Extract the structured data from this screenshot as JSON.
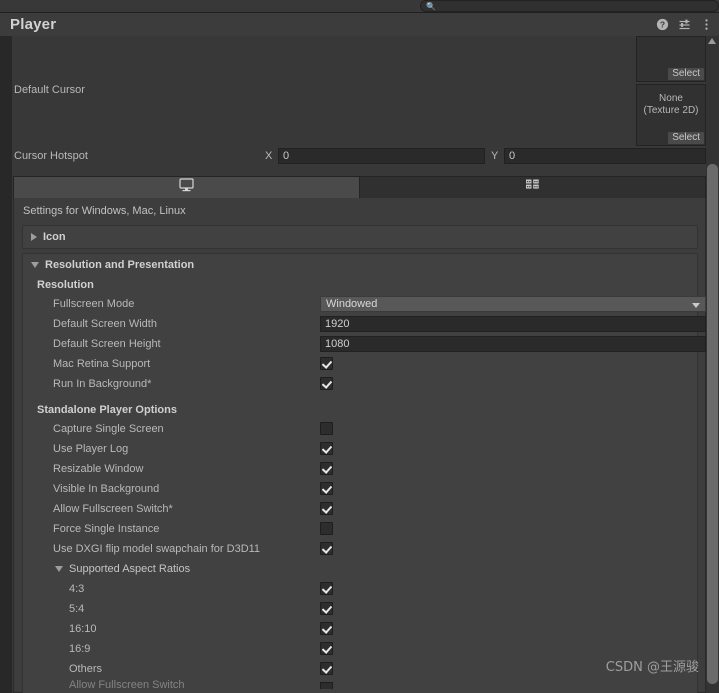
{
  "search": {
    "value": "",
    "placeholder": "",
    "icon": "search-icon"
  },
  "header": {
    "title": "Player",
    "icons": [
      {
        "name": "help-icon",
        "label": "?"
      },
      {
        "name": "preset-icon",
        "label": ""
      },
      {
        "name": "more-menu-icon",
        "label": ""
      }
    ]
  },
  "top_section": {
    "pickers": [
      {
        "name": "picker-top",
        "label": "",
        "select_label": "Select"
      },
      {
        "name": "picker-default-cursor",
        "label": "None\n(Texture 2D)",
        "line1": "None",
        "line2": "(Texture 2D)",
        "select_label": "Select"
      }
    ],
    "default_cursor_label": "Default Cursor",
    "cursor_hotspot": {
      "label": "Cursor Hotspot",
      "x_label": "X",
      "x_value": "0",
      "y_label": "Y",
      "y_value": "0"
    }
  },
  "tabs": [
    {
      "name": "tab-standalone",
      "icon": "monitor-icon",
      "active": true
    },
    {
      "name": "tab-webgl",
      "icon": "grid-server-icon",
      "active": false
    }
  ],
  "panel": {
    "settings_for": "Settings for Windows, Mac, Linux",
    "icon_foldout": {
      "label": "Icon",
      "expanded": false
    },
    "resolution_foldout": {
      "label": "Resolution and Presentation",
      "expanded": true
    },
    "resolution_group": {
      "heading": "Resolution",
      "fullscreen_mode": {
        "label": "Fullscreen Mode",
        "value": "Windowed"
      },
      "default_screen_width": {
        "label": "Default Screen Width",
        "value": "1920"
      },
      "default_screen_height": {
        "label": "Default Screen Height",
        "value": "1080"
      },
      "checkboxes": [
        {
          "label": "Mac Retina Support",
          "checked": true
        },
        {
          "label": "Run In Background*",
          "checked": true
        }
      ]
    },
    "standalone_group": {
      "heading": "Standalone Player Options",
      "checkboxes": [
        {
          "label": "Capture Single Screen",
          "checked": false
        },
        {
          "label": "Use Player Log",
          "checked": true
        },
        {
          "label": "Resizable Window",
          "checked": true
        },
        {
          "label": "Visible In Background",
          "checked": true
        },
        {
          "label": "Allow Fullscreen Switch*",
          "checked": true
        },
        {
          "label": "Force Single Instance",
          "checked": false
        },
        {
          "label": "Use DXGI flip model swapchain for D3D11",
          "checked": true
        }
      ]
    },
    "aspect_ratios": {
      "heading": "Supported Aspect Ratios",
      "expanded": true,
      "items": [
        {
          "label": "4:3",
          "checked": true
        },
        {
          "label": "5:4",
          "checked": true
        },
        {
          "label": "16:10",
          "checked": true
        },
        {
          "label": "16:9",
          "checked": true
        },
        {
          "label": "Others",
          "checked": true
        }
      ]
    },
    "clipped_row": {
      "label": "Allow Fullscreen Switch",
      "checked": false
    }
  },
  "scrollbar": {
    "name": "vertical-scrollbar"
  },
  "watermark": "CSDN @王源骏",
  "colors": {
    "window_bg": "#282828",
    "panel_bg": "#3d3d3d",
    "header_bg": "#3c3c3c",
    "field_bg": "#2a2a2a",
    "dropdown_bg": "#585858",
    "tab_active": "#4a4a4a",
    "text": "#b8b8b8"
  }
}
